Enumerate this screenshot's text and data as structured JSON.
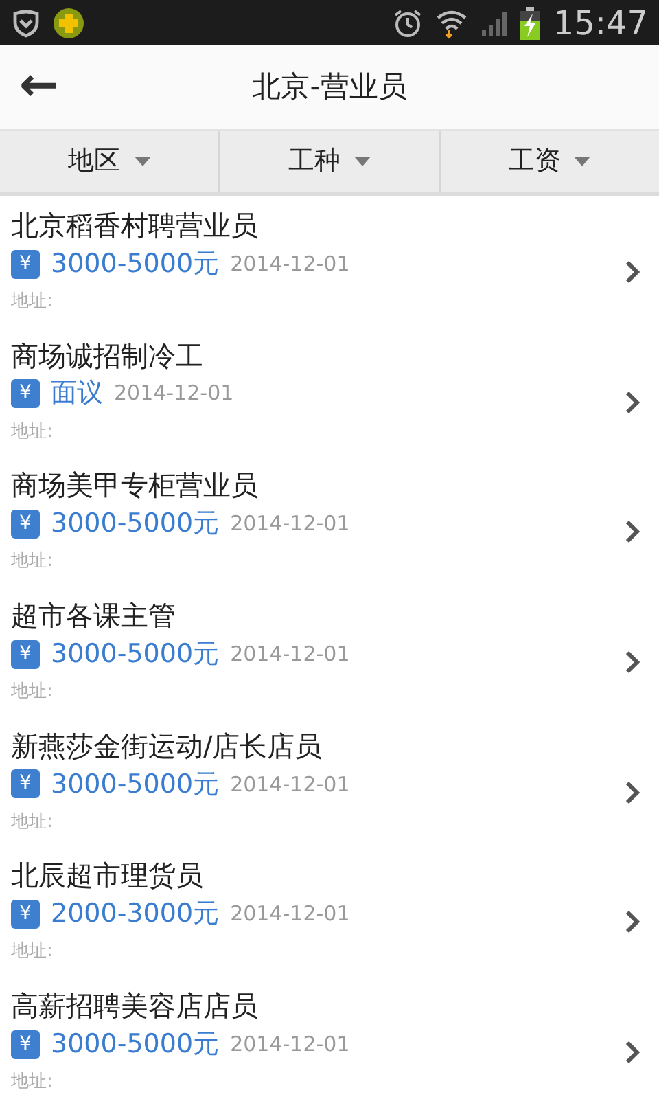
{
  "status_bar": {
    "time": "15:47"
  },
  "app_bar": {
    "back": "←",
    "title": "北京-营业员"
  },
  "filters": [
    {
      "label": "地区"
    },
    {
      "label": "工种"
    },
    {
      "label": "工资"
    }
  ],
  "jobs": [
    {
      "title": "北京稻香村聘营业员",
      "badge": "¥",
      "salary": "3000-5000元",
      "date": "2014-12-01",
      "address": "地址:"
    },
    {
      "title": "商场诚招制冷工",
      "badge": "¥",
      "salary": "面议",
      "date": "2014-12-01",
      "address": "地址:"
    },
    {
      "title": "商场美甲专柜营业员",
      "badge": "¥",
      "salary": "3000-5000元",
      "date": "2014-12-01",
      "address": "地址:"
    },
    {
      "title": "超市各课主管",
      "badge": "¥",
      "salary": "3000-5000元",
      "date": "2014-12-01",
      "address": "地址:"
    },
    {
      "title": "新燕莎金街运动/店长店员",
      "badge": "¥",
      "salary": "3000-5000元",
      "date": "2014-12-01",
      "address": "地址:"
    },
    {
      "title": "北辰超市理货员",
      "badge": "¥",
      "salary": "2000-3000元",
      "date": "2014-12-01",
      "address": "地址:"
    },
    {
      "title": "高薪招聘美容店店员",
      "badge": "¥",
      "salary": "3000-5000元",
      "date": "2014-12-01",
      "address": "地址:"
    }
  ]
}
